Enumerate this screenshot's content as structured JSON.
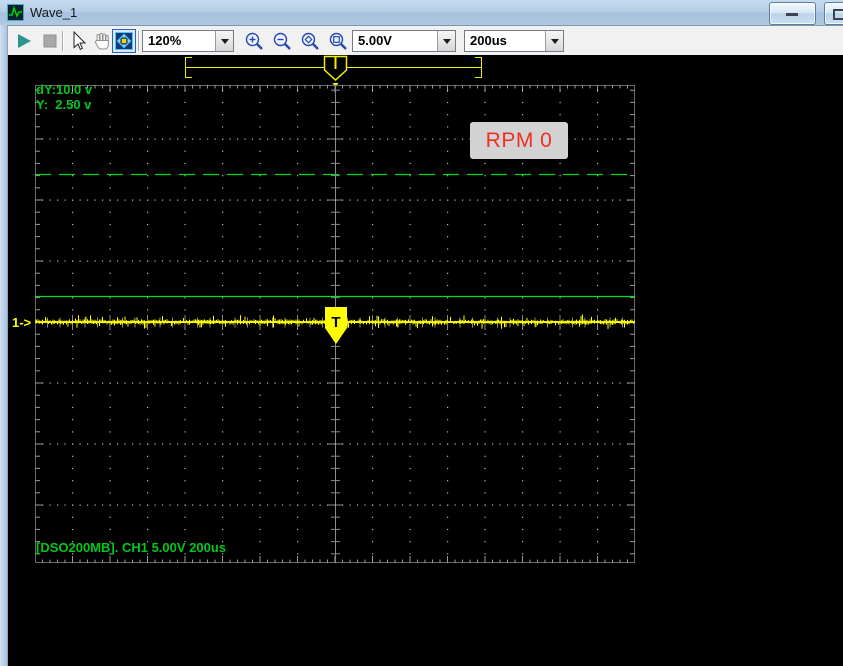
{
  "window": {
    "title": "Wave_1"
  },
  "toolbar": {
    "zoom_value": "120%",
    "volts_value": "5.00V",
    "time_value": "200us"
  },
  "scope": {
    "readout_dy": "dY:10.0 v",
    "readout_y": "Y:  2.50 v",
    "rpm_text": "RPM 0",
    "status_text": "[DSO200MB]. CH1 5.00V 200us",
    "channel_marker": "1->",
    "trigger_label": "T",
    "colors": {
      "trace": "#ffff00",
      "cursor_green": "#00dc28",
      "readout_green": "#00c81e",
      "grid_dot": "#bcbcbc",
      "grid_tick": "#9a9a9a",
      "grid_border": "#6a6a6a",
      "ruler_gray": "#8a8a8a",
      "ruler_yellow": "#efef00",
      "rpm_text_color": "#ee3122",
      "rpm_bg": "#d3d3d3"
    }
  }
}
